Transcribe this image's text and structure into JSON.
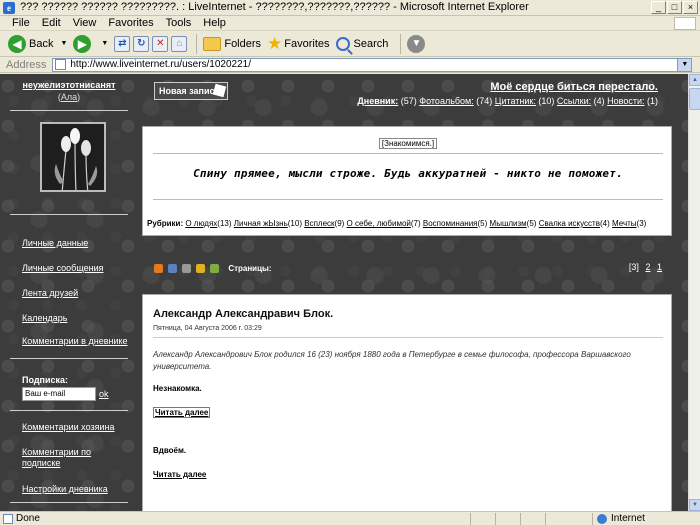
{
  "window": {
    "title": "??? ?????? ?????? ?????????. : LiveInternet - ????????,???????,?????? - Microsoft Internet Explorer"
  },
  "menu": [
    "File",
    "Edit",
    "View",
    "Favorites",
    "Tools",
    "Help"
  ],
  "toolbar": {
    "back": "Back",
    "folders": "Folders",
    "favorites": "Favorites",
    "search": "Search"
  },
  "address": {
    "label": "Address",
    "url": "http://www.liveinternet.ru/users/1020221/"
  },
  "sidebar": {
    "user_name": "неужелиэтотнисанят",
    "alias_open": "(",
    "alias": "Ала",
    "alias_close": ")",
    "nav": [
      "Личные данные",
      "Личные сообщения",
      "Лента друзей",
      "Календарь",
      "Комментарии в дневнике"
    ],
    "subscription_label": "Подписка:",
    "email_placeholder": "Ваш e-mail",
    "ok": "ok",
    "nav2": [
      "Комментарии хозяина",
      "Комментарии по подписке",
      "Настройки дневника"
    ]
  },
  "main": {
    "new_post": "Новая запись",
    "blog_title": "Моё сердце биться перестало.",
    "diary_label": "Дневник:",
    "diary_stats": [
      {
        "count": "(57)",
        "label": "Фотоальбом:"
      },
      {
        "count": "(74)",
        "label": "Цитатник:"
      },
      {
        "count": "(10)",
        "label": "Ссылки:"
      },
      {
        "count": "(4)",
        "label": "Новости:"
      },
      {
        "count": "(1)",
        "label": ""
      }
    ],
    "meet": "[Знакомимся.]",
    "motto": "Спину прямее, мысли строже. Будь аккуратней - никто не поможет.",
    "rubrics_label": "Рубрики:",
    "rubrics": [
      {
        "name": "О людях",
        "count": "(13)"
      },
      {
        "name": "Личная жЫзнь",
        "count": "(10)"
      },
      {
        "name": "Всплеск",
        "count": "(9)"
      },
      {
        "name": "О себе, любимой",
        "count": "(7)"
      },
      {
        "name": "Воспоминания",
        "count": "(5)"
      },
      {
        "name": "Мышлизм",
        "count": "(5)"
      },
      {
        "name": "Свалка искусств",
        "count": "(4)"
      },
      {
        "name": "Мечты",
        "count": "(3)"
      }
    ],
    "pages_label": "Страницы:",
    "pages_current": "[3]",
    "pages": [
      "2",
      "1"
    ],
    "post": {
      "title": "Александр Александравич Блок.",
      "date": "Пятница, 04 Августа 2006 г. 03:29",
      "intro": "Александр Александрович Блок родился 16 (23) ноября 1880 года в Петербурге в семье философа, профессора Варшавского университета.",
      "poem1": "Незнакомка.",
      "read_more1": "Читать далее",
      "poem2": "Вдвоём.",
      "read_more2": "Читать далее"
    }
  },
  "status": {
    "text": "Done",
    "zone": "Internet"
  }
}
